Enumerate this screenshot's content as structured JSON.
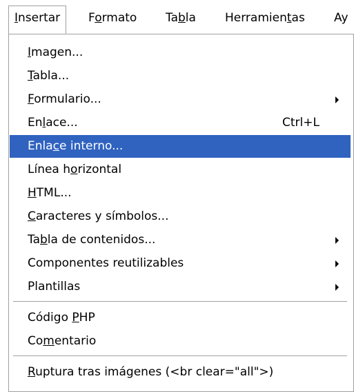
{
  "menubar": {
    "items": [
      {
        "pre": "",
        "u": "I",
        "post": "nsertar"
      },
      {
        "pre": "F",
        "u": "o",
        "post": "rmato"
      },
      {
        "pre": "Ta",
        "u": "b",
        "post": "la"
      },
      {
        "pre": "Herramien",
        "u": "t",
        "post": "as"
      },
      {
        "pre": "Ay",
        "u": "",
        "post": ""
      }
    ]
  },
  "menu": {
    "items": [
      {
        "pre": "",
        "u": "I",
        "post": "magen...",
        "accel": "",
        "submenu": false
      },
      {
        "pre": "",
        "u": "T",
        "post": "abla...",
        "accel": "",
        "submenu": false
      },
      {
        "pre": "",
        "u": "F",
        "post": "ormulario...",
        "accel": "",
        "submenu": true
      },
      {
        "pre": "En",
        "u": "l",
        "post": "ace...",
        "accel": "Ctrl+L",
        "submenu": false
      },
      {
        "pre": "Enla",
        "u": "c",
        "post": "e interno...",
        "accel": "",
        "submenu": false,
        "selected": true
      },
      {
        "pre": "Línea h",
        "u": "o",
        "post": "rizontal",
        "accel": "",
        "submenu": false
      },
      {
        "pre": "",
        "u": "H",
        "post": "TML...",
        "accel": "",
        "submenu": false
      },
      {
        "pre": "",
        "u": "C",
        "post": "aracteres y símbolos...",
        "accel": "",
        "submenu": false
      },
      {
        "pre": "Ta",
        "u": "b",
        "post": "la de contenidos...",
        "accel": "",
        "submenu": true
      },
      {
        "pre": "Componentes reutilizables",
        "u": "",
        "post": "",
        "accel": "",
        "submenu": true
      },
      {
        "pre": "Plantillas",
        "u": "",
        "post": "",
        "accel": "",
        "submenu": true
      },
      {
        "pre": "Código ",
        "u": "P",
        "post": "HP",
        "accel": "",
        "submenu": false
      },
      {
        "pre": "Co",
        "u": "m",
        "post": "entario",
        "accel": "",
        "submenu": false
      },
      {
        "pre": "",
        "u": "R",
        "post": "uptura tras imágenes (<br clear=\"all\">)",
        "accel": "",
        "submenu": false
      }
    ]
  },
  "colors": {
    "selection": "#3063c0",
    "separator": "#a0a0a0"
  }
}
